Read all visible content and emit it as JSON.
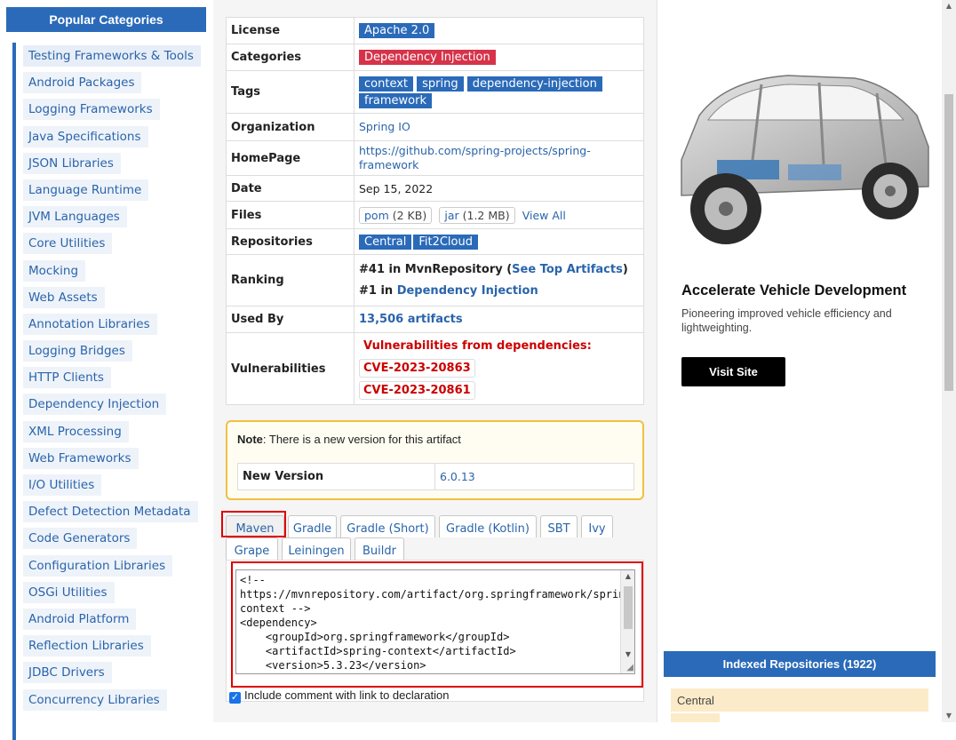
{
  "sidebar": {
    "header": "Popular Categories",
    "items": [
      {
        "label": "Testing Frameworks & Tools"
      },
      {
        "label": "Android Packages"
      },
      {
        "label": "Logging Frameworks"
      },
      {
        "label": "Java Specifications"
      },
      {
        "label": "JSON Libraries"
      },
      {
        "label": "Language Runtime"
      },
      {
        "label": "JVM Languages"
      },
      {
        "label": "Core Utilities"
      },
      {
        "label": "Mocking"
      },
      {
        "label": "Web Assets"
      },
      {
        "label": "Annotation Libraries"
      },
      {
        "label": "Logging Bridges"
      },
      {
        "label": "HTTP Clients"
      },
      {
        "label": "Dependency Injection"
      },
      {
        "label": "XML Processing"
      },
      {
        "label": "Web Frameworks"
      },
      {
        "label": "I/O Utilities"
      },
      {
        "label": "Defect Detection Metadata"
      },
      {
        "label": "Code Generators"
      },
      {
        "label": "Configuration Libraries"
      },
      {
        "label": "OSGi Utilities"
      },
      {
        "label": "Android Platform"
      },
      {
        "label": "Reflection Libraries"
      },
      {
        "label": "JDBC Drivers"
      },
      {
        "label": "Concurrency Libraries"
      }
    ]
  },
  "info": {
    "license_label": "License",
    "license": "Apache 2.0",
    "categories_label": "Categories",
    "category": "Dependency Injection",
    "tags_label": "Tags",
    "tags": [
      "context",
      "spring",
      "dependency-injection",
      "framework"
    ],
    "organization_label": "Organization",
    "organization": "Spring IO",
    "homepage_label": "HomePage",
    "homepage_line1": "https://github.com/spring-projects/spring-",
    "homepage_line2": "framework",
    "date_label": "Date",
    "date": "Sep 15, 2022",
    "files_label": "Files",
    "files": [
      {
        "name": "pom",
        "size": "(2 KB)"
      },
      {
        "name": "jar",
        "size": "(1.2 MB)"
      }
    ],
    "view_all": "View All",
    "repositories_label": "Repositories",
    "repositories": [
      "Central",
      "Fit2Cloud"
    ],
    "ranking_label": "Ranking",
    "rank1_prefix": "#41 in MvnRepository (",
    "rank1_link": "See Top Artifacts",
    "rank1_suffix": ")",
    "rank2_prefix": "#1 in ",
    "rank2_link": "Dependency Injection",
    "used_by_label": "Used By",
    "used_by": "13,506 artifacts",
    "vulnerabilities_label": "Vulnerabilities",
    "vuln_title": "Vulnerabilities from dependencies:",
    "cves": [
      "CVE-2023-20863",
      "CVE-2023-20861"
    ]
  },
  "note": {
    "bold": "Note",
    "text": ": There is a new version for this artifact",
    "new_version_label": "New Version",
    "new_version": "6.0.13"
  },
  "build_tabs": {
    "row1": [
      "Maven",
      "Gradle",
      "Gradle (Short)",
      "Gradle (Kotlin)",
      "SBT",
      "Ivy"
    ],
    "row2": [
      "Grape",
      "Leiningen",
      "Buildr"
    ],
    "active": "Maven"
  },
  "snippet": "<!--\nhttps://mvnrepository.com/artifact/org.springframework/spring-context -->\n<dependency>\n    <groupId>org.springframework</groupId>\n    <artifactId>spring-context</artifactId>\n    <version>5.3.23</version>\n</dependency>",
  "include_comment": "Include comment with link to declaration",
  "ad": {
    "title": "Accelerate Vehicle Development",
    "desc": "Pioneering improved vehicle efficiency and lightweighting.",
    "button": "Visit Site"
  },
  "repos": {
    "header": "Indexed Repositories (1922)",
    "first": "Central"
  },
  "colors": {
    "accent": "#2a6ab9",
    "tag_red": "#d6334a",
    "alert_red": "#cc0000",
    "note_border": "#f0c040",
    "highlight": "#e00000"
  }
}
